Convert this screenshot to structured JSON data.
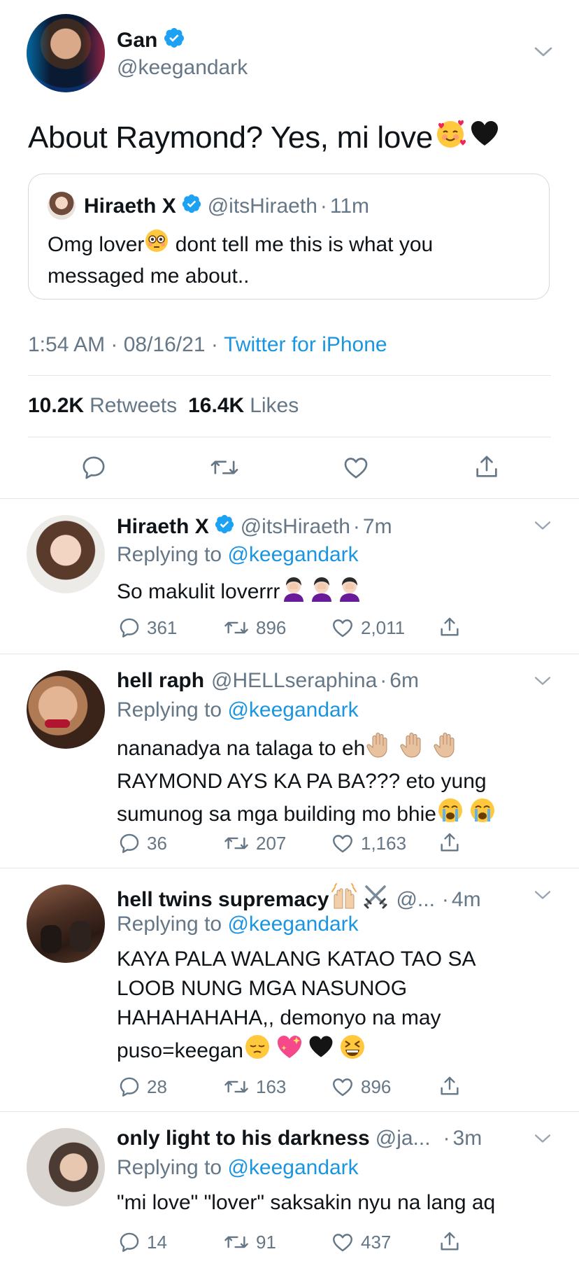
{
  "main_tweet": {
    "display_name": "Gan",
    "handle": "@keegandark",
    "text": "About Raymond? Yes, mi love",
    "text_emojis": [
      "smiling-face-with-hearts",
      "black-heart"
    ],
    "quoted": {
      "display_name": "Hiraeth X",
      "handle": "@itsHiraeth",
      "time": "11m",
      "text_line1_a": "Omg lover",
      "text_line1_b": " dont tell me this is what you",
      "text_line2": "messaged me about.."
    },
    "timestamp": "1:54 AM · 08/16/21 · ",
    "source": "Twitter for iPhone",
    "retweets_count": "10.2K",
    "retweets_label": "Retweets",
    "likes_count": "16.4K",
    "likes_label": "Likes"
  },
  "replies": [
    {
      "display_name": "Hiraeth X",
      "handle": "@itsHiraeth",
      "time": "7m",
      "replying_prefix": "Replying to ",
      "replying_to": "@keegandark",
      "lines": [
        "So makulit loverrr"
      ],
      "reply_count": "361",
      "retweet_count": "896",
      "like_count": "2,011"
    },
    {
      "display_name": "hell raph",
      "handle": "@HELLseraphina",
      "time": "6m",
      "replying_prefix": "Replying to ",
      "replying_to": "@keegandark",
      "lines": [
        "nananadya na talaga to eh",
        "RAYMOND AYS KA PA BA??? eto yung",
        "sumunog sa mga building mo bhie"
      ],
      "reply_count": "36",
      "retweet_count": "207",
      "like_count": "1,163"
    },
    {
      "display_name": "hell twins supremacy",
      "handle": "@...",
      "time": "4m",
      "replying_prefix": "Replying to ",
      "replying_to": "@keegandark",
      "lines": [
        "KAYA PALA WALANG KATAO TAO SA",
        "LOOB NUNG MGA NASUNOG",
        "HAHAHAHAHA,, demonyo na may",
        "puso=keegan"
      ],
      "reply_count": "28",
      "retweet_count": "163",
      "like_count": "896"
    },
    {
      "display_name": "only light to his darkness",
      "handle": "@ja...",
      "time": "3m",
      "replying_prefix": "Replying to ",
      "replying_to": "@keegandark",
      "lines": [
        "\"mi love\" \"lover\" saksakin nyu na lang aq"
      ],
      "reply_count": "14",
      "retweet_count": "91",
      "like_count": "437"
    }
  ],
  "colors": {
    "text": "#0f1419",
    "secondary": "#657786",
    "link": "#1b95e0",
    "verified": "#1da1f2",
    "divider": "#e1e8ed"
  }
}
